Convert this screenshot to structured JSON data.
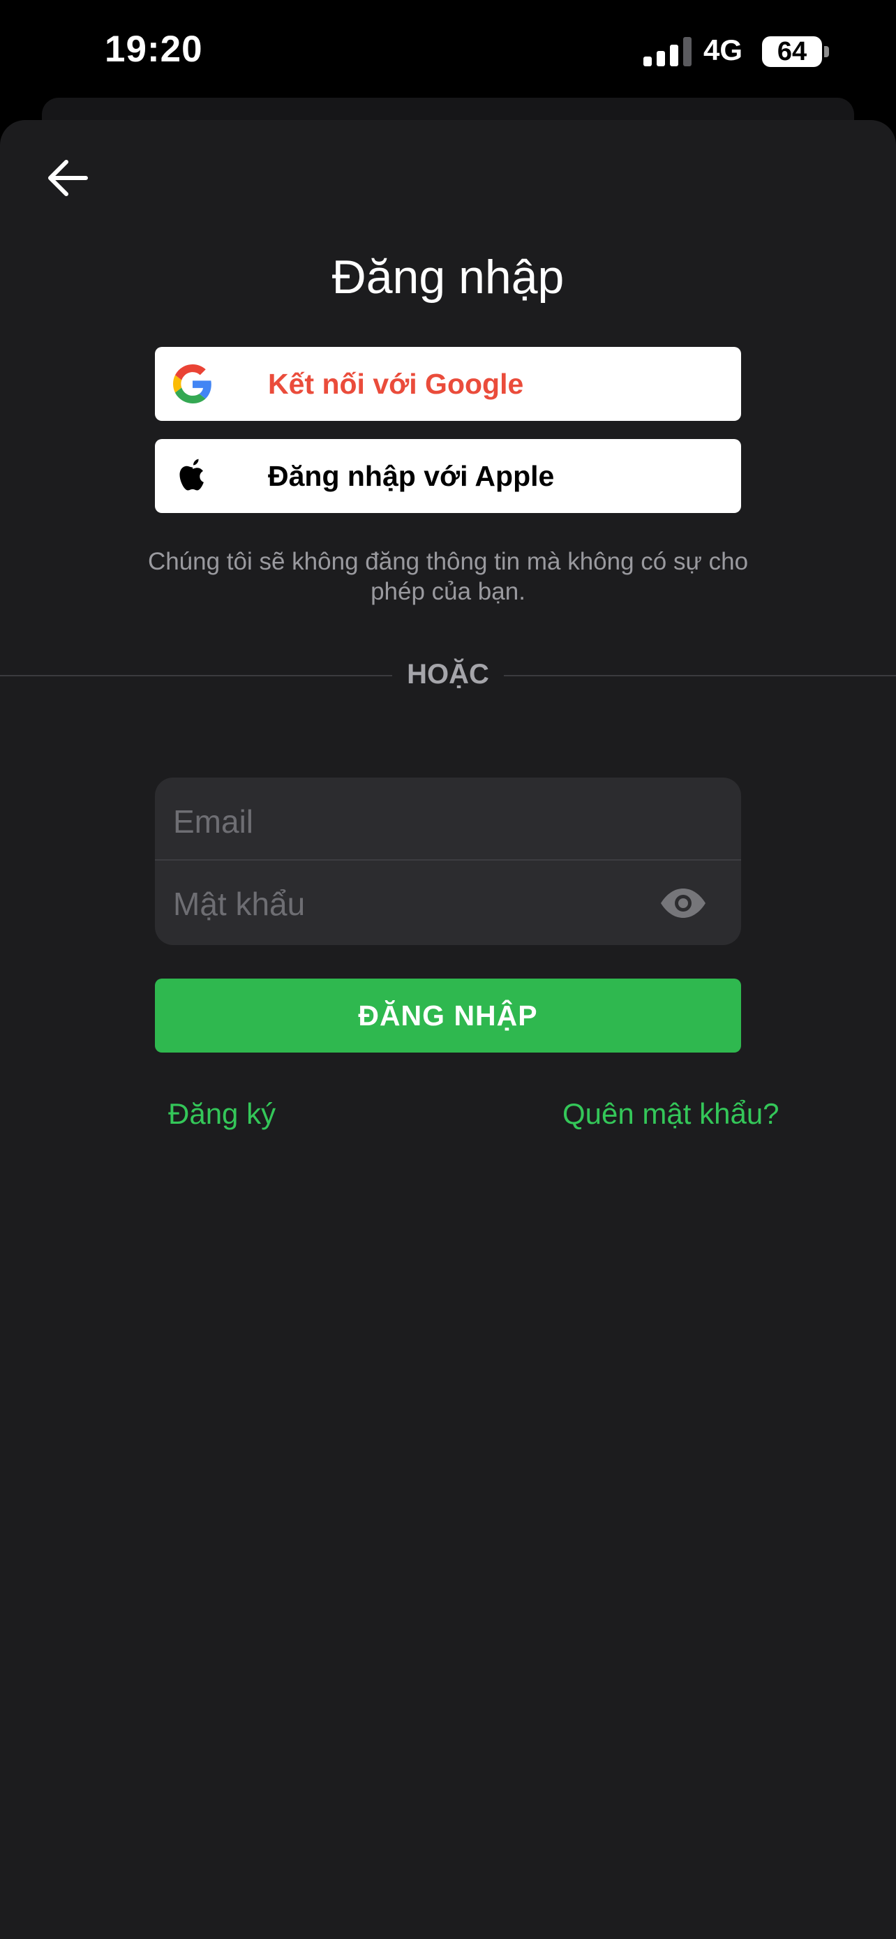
{
  "status_bar": {
    "time": "19:20",
    "network": "4G",
    "battery": "64"
  },
  "header": {
    "title": "Đăng nhập"
  },
  "social": {
    "google_label": "Kết nối với Google",
    "apple_label": "Đăng nhập với Apple"
  },
  "privacy_note": "Chúng tôi sẽ không đăng thông tin mà không có sự cho phép của bạn.",
  "divider": {
    "text": "HOẶC"
  },
  "form": {
    "email_placeholder": "Email",
    "password_placeholder": "Mật khẩu",
    "submit_label": "ĐĂNG NHẬP"
  },
  "links": {
    "register": "Đăng ký",
    "forgot_password": "Quên mật khẩu?"
  },
  "icons": {
    "back": "arrow-left-icon",
    "google": "google-logo-icon",
    "apple": "apple-logo-icon",
    "password_visibility": "eye-icon",
    "signal": "cellular-signal-icon",
    "battery": "battery-icon"
  },
  "colors": {
    "sheet_background": "#1c1c1e",
    "primary_button": "#2fb84f",
    "link": "#34c759",
    "google_label": "#ea4c3b",
    "input_background": "#2c2c2f"
  }
}
